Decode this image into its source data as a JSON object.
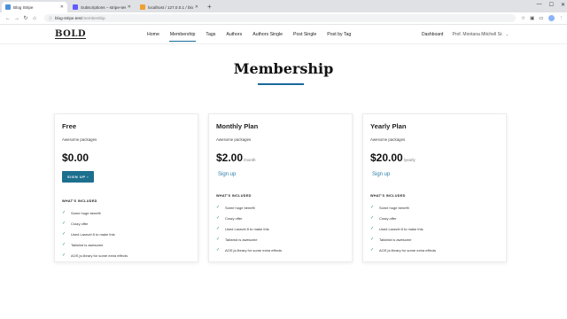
{
  "browser": {
    "tabs": [
      {
        "title": "Blog Stripe",
        "active": true,
        "favicon_color": "#4a90d9"
      },
      {
        "title": "Subscriptions – stripe-test – St",
        "active": false,
        "favicon_color": "#635bff"
      },
      {
        "title": "localhost / 127.0.0.1 / blog-str",
        "active": false,
        "favicon_color": "#f0a030"
      }
    ],
    "new_tab": "+",
    "url_host": "blog-stripe.test",
    "url_path": "/membership"
  },
  "site": {
    "logo": "BOLD",
    "nav": [
      {
        "label": "Home"
      },
      {
        "label": "Membership",
        "active": true
      },
      {
        "label": "Tags"
      },
      {
        "label": "Authors"
      },
      {
        "label": "Authors Single"
      },
      {
        "label": "Post Single"
      },
      {
        "label": "Post by Tag"
      }
    ],
    "dashboard": "Dashboard",
    "user": "Prof. Montana Mitchell Sr."
  },
  "page": {
    "title": "Membership",
    "accent_color": "#1a6a9a"
  },
  "plans": [
    {
      "name": "Free",
      "desc": "Awesome packages",
      "price": "$0.00",
      "period": "",
      "cta": "SIGN UP",
      "included_label": "WHAT'S INCLUDED",
      "features": [
        "Some huge benefit",
        "Crazy offer",
        "Used Laravel 8 to make this",
        "Tailwind is awesome",
        "AOS js library for some extra effects"
      ]
    },
    {
      "name": "Monthly Plan",
      "desc": "Awesome packages",
      "price": "$2.00",
      "period": "/month",
      "cta": "Sign up",
      "included_label": "WHAT'S INCLUDED",
      "features": [
        "Some huge benefit",
        "Crazy offer",
        "Used Laravel 8 to make this",
        "Tailwind is awesome",
        "AOS js library for some extra effects"
      ]
    },
    {
      "name": "Yearly Plan",
      "desc": "Awesome packages",
      "price": "$20.00",
      "period": "/yearly",
      "cta": "Sign up",
      "included_label": "WHAT'S INCLUDED",
      "features": [
        "Some huge benefit",
        "Crazy offer",
        "Used Laravel 8 to make this",
        "Tailwind is awesome",
        "AOS js library for some extra effects"
      ]
    }
  ]
}
